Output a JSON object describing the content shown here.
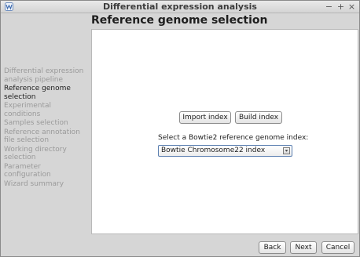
{
  "window": {
    "title": "Differential expression analysis",
    "controls": {
      "minimize": "−",
      "maximize": "+",
      "close": "×"
    },
    "icon": "app-icon"
  },
  "page": {
    "title": "Reference genome selection"
  },
  "sidebar": {
    "items": [
      {
        "label": "Differential expression analysis pipeline",
        "active": false
      },
      {
        "label": "Reference genome selection",
        "active": true
      },
      {
        "label": "Experimental conditions",
        "active": false
      },
      {
        "label": "Samples selection",
        "active": false
      },
      {
        "label": "Reference annotation file selection",
        "active": false
      },
      {
        "label": "Working directory selection",
        "active": false
      },
      {
        "label": "Parameter configuration",
        "active": false
      },
      {
        "label": "Wizard summary",
        "active": false
      }
    ]
  },
  "main": {
    "import_index_label": "Import index",
    "build_index_label": "Build index",
    "select_label": "Select a Bowtie2 reference genome index:",
    "selected_index": "Bowtie Chromosome22 index"
  },
  "footer": {
    "back_label": "Back",
    "next_label": "Next",
    "cancel_label": "Cancel"
  },
  "colors": {
    "panel": "#d6d6d6",
    "content": "#ffffff",
    "inactive_step": "#9a9a9a",
    "active_step": "#1e1e1e",
    "select_border": "#5b7fb0"
  }
}
